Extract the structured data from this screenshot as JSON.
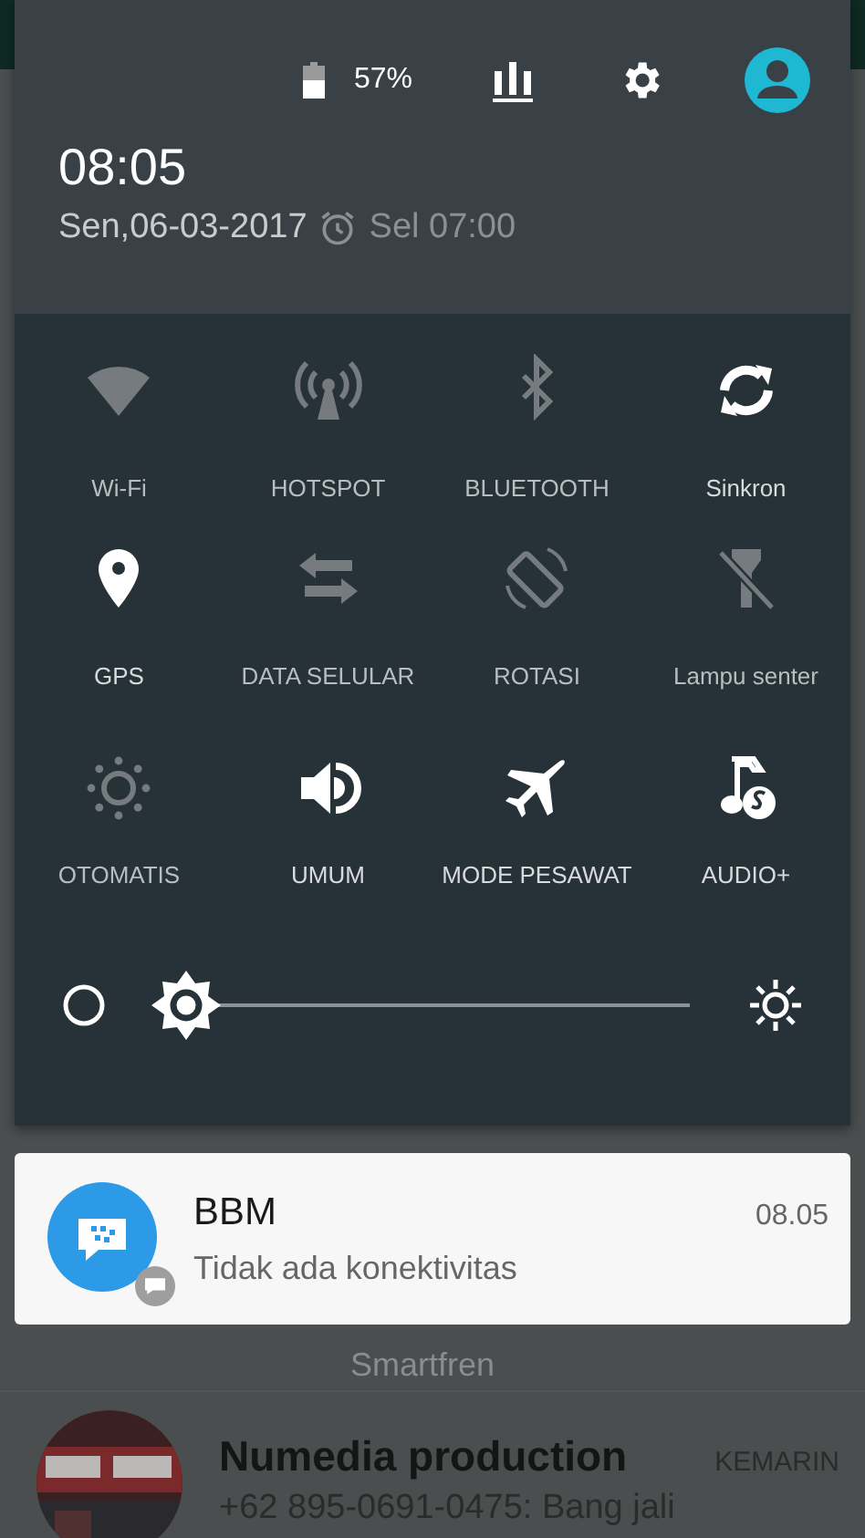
{
  "status": {
    "battery": "57%"
  },
  "clock": {
    "time": "08:05",
    "date": "Sen,06-03-2017",
    "alarm": "Sel 07:00"
  },
  "tiles": [
    {
      "kind": "wifi",
      "label": "Wi-Fi",
      "on": false
    },
    {
      "kind": "hotspot",
      "label": "HOTSPOT",
      "on": false
    },
    {
      "kind": "bluetooth",
      "label": "BLUETOOTH",
      "on": false
    },
    {
      "kind": "sync",
      "label": "Sinkron",
      "on": true
    },
    {
      "kind": "gps",
      "label": "GPS",
      "on": true
    },
    {
      "kind": "data",
      "label": "DATA SELULAR",
      "on": false
    },
    {
      "kind": "rotation",
      "label": "ROTASI",
      "on": false
    },
    {
      "kind": "flashlight",
      "label": "Lampu senter",
      "on": false
    },
    {
      "kind": "auto",
      "label": "OTOMATIS",
      "on": false
    },
    {
      "kind": "sound",
      "label": "UMUM",
      "on": true
    },
    {
      "kind": "airplane",
      "label": "MODE PESAWAT",
      "on": true
    },
    {
      "kind": "audio",
      "label": "AUDIO+",
      "on": true
    }
  ],
  "brightness": {
    "level": 0.06
  },
  "notification": {
    "app": "BBM",
    "time": "08.05",
    "text": "Tidak ada konektivitas"
  },
  "background_chat": {
    "name": "Numedia production",
    "time": "KEMARIN",
    "preview": "+62 895-0691-0475: Bang jali"
  },
  "carrier": "Smartfren"
}
